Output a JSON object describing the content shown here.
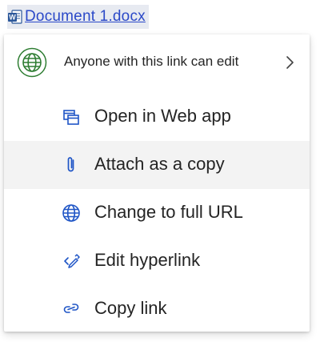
{
  "document_link": {
    "icon": "word-document-icon",
    "label": "Document 1.docx",
    "color": "#2b49c8"
  },
  "menu": {
    "share": {
      "icon": "globe-icon",
      "label": "Anyone with this link can edit",
      "accent_color": "#2e7d32",
      "chevron": "chevron-right-icon"
    },
    "items": [
      {
        "icon": "open-in-web-app-icon",
        "label": "Open in Web app"
      },
      {
        "icon": "paperclip-icon",
        "label": "Attach as a copy"
      },
      {
        "icon": "globe-icon",
        "label": "Change to full URL"
      },
      {
        "icon": "edit-hyperlink-icon",
        "label": "Edit hyperlink"
      },
      {
        "icon": "link-icon",
        "label": "Copy link"
      }
    ],
    "highlighted_index": 1
  },
  "colors": {
    "icon_blue": "#1f55c6",
    "hover_background": "#f3f3f3",
    "link_highlight_background": "#e7eaf1"
  }
}
